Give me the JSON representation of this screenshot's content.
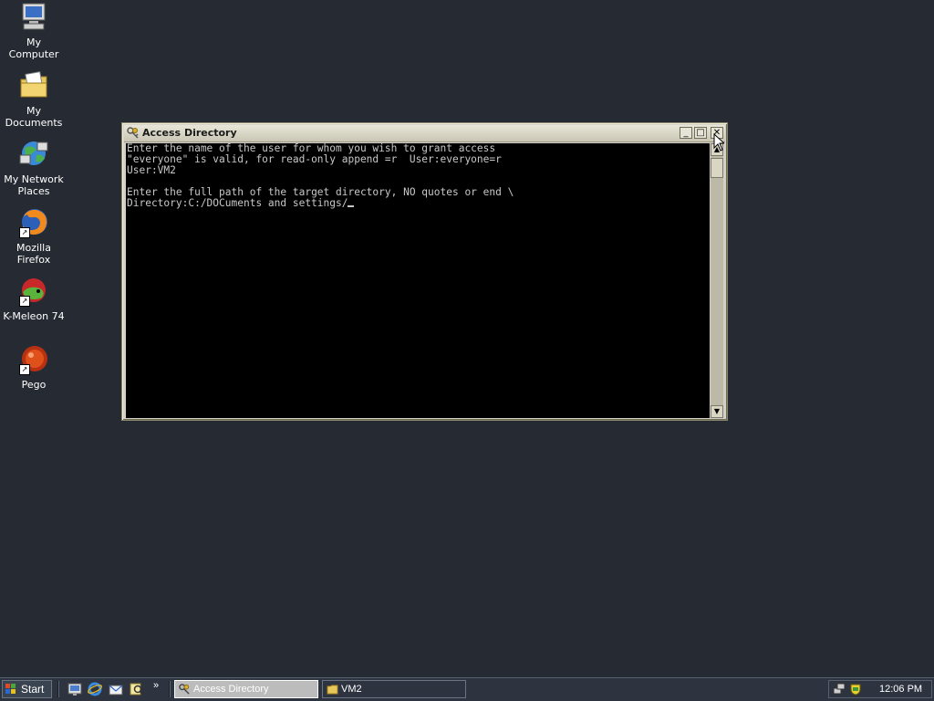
{
  "desktop": {
    "icons": [
      {
        "label": "My Computer",
        "icon": "computer-icon"
      },
      {
        "label": "My Documents",
        "icon": "documents-folder-icon"
      },
      {
        "label": "My Network Places",
        "icon": "network-places-icon"
      },
      {
        "label": "Mozilla Firefox",
        "icon": "firefox-icon"
      },
      {
        "label": "K-Meleon 74",
        "icon": "kmeleon-icon"
      },
      {
        "label": "Pego",
        "icon": "pego-icon"
      }
    ]
  },
  "window": {
    "title": "Access Directory",
    "buttons": {
      "minimize": "_",
      "maximize": "□",
      "close": "✕"
    },
    "console_lines": [
      "Enter the name of the user for whom you wish to grant access",
      "\"everyone\" is valid, for read-only append =r  User:everyone=r",
      "User:VM2",
      "",
      "Enter the full path of the target directory, NO quotes or end \\",
      "Directory:C:/DOCuments and settings/"
    ]
  },
  "taskbar": {
    "start_label": "Start",
    "quick_launch": [
      "show-desktop-icon",
      "ie-icon",
      "outlook-icon",
      "search-icon"
    ],
    "more_label": "»",
    "tasks": [
      {
        "label": "Access Directory",
        "active": true
      },
      {
        "label": "VM2",
        "active": false
      }
    ],
    "clock": "12:06 PM"
  },
  "colors": {
    "desktop_bg": "#262b33",
    "console_bg": "#000000",
    "console_text": "#c8c8c8",
    "taskbar_bg": "#2d3440"
  }
}
